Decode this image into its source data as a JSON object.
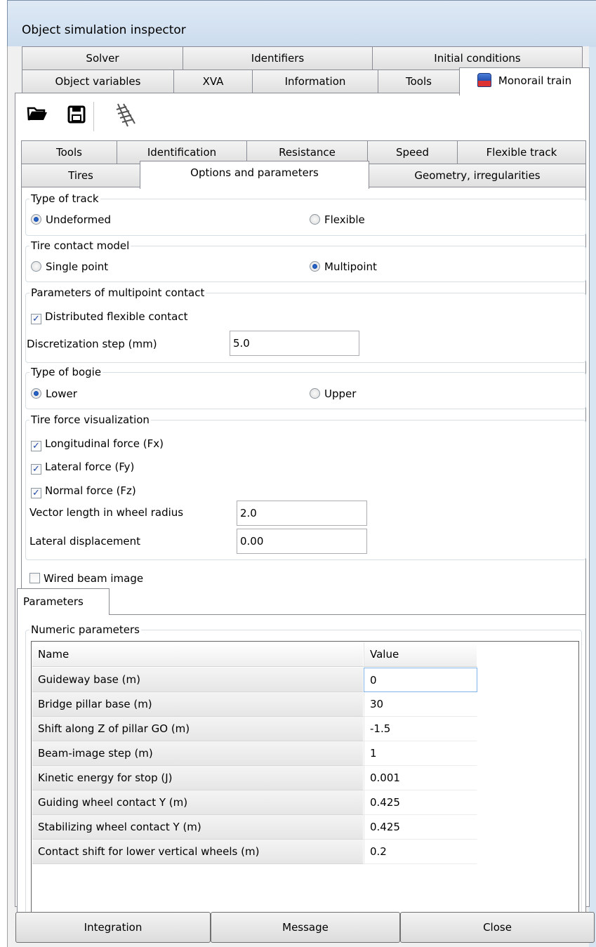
{
  "window": {
    "title": "Object simulation inspector"
  },
  "main_tabs": {
    "row1": [
      "Solver",
      "Identifiers",
      "Initial conditions"
    ],
    "row2": [
      "Object variables",
      "XVA",
      "Information",
      "Tools",
      "Monorail train"
    ]
  },
  "toolbar": {
    "icons": [
      "open-folder-icon",
      "save-icon",
      "track-icon"
    ]
  },
  "sub_tabs": {
    "row1": [
      "Tools",
      "Identification",
      "Resistance",
      "Speed",
      "Flexible track"
    ],
    "row2": [
      "Tires",
      "Options and parameters",
      "Geometry, irregularities"
    ]
  },
  "type_of_track": {
    "label": "Type of track",
    "options": [
      "Undeformed",
      "Flexible"
    ],
    "selected": "Undeformed"
  },
  "tire_contact_model": {
    "label": "Tire contact model",
    "options": [
      "Single point",
      "Multipoint"
    ],
    "selected": "Multipoint"
  },
  "multipoint": {
    "label": "Parameters of multipoint contact",
    "distributed_label": "Distributed flexible contact",
    "distributed_checked": true,
    "step_label": "Discretization step (mm)",
    "step_value": "5.0"
  },
  "type_of_bogie": {
    "label": "Type of bogie",
    "options": [
      "Lower",
      "Upper"
    ],
    "selected": "Lower"
  },
  "tire_force": {
    "label": "Tire force visualization",
    "fx_label": "Longitudinal force (Fx)",
    "fx_checked": true,
    "fy_label": "Lateral force (Fy)",
    "fy_checked": true,
    "fz_label": "Normal force (Fz)",
    "fz_checked": true,
    "vector_label": "Vector length in wheel radius",
    "vector_value": "2.0",
    "lateral_label": "Lateral displacement",
    "lateral_value": "0.00"
  },
  "wired_beam": {
    "label": "Wired beam image",
    "checked": false
  },
  "parameters_tab": "Parameters",
  "numeric": {
    "label": "Numeric parameters",
    "col_name": "Name",
    "col_value": "Value",
    "rows": [
      {
        "name": "Guideway base (m)",
        "value": "0"
      },
      {
        "name": "Bridge pillar base (m)",
        "value": "30"
      },
      {
        "name": "Shift along Z of pillar GO (m)",
        "value": "-1.5"
      },
      {
        "name": "Beam-image step (m)",
        "value": "1"
      },
      {
        "name": "Kinetic energy for stop (J)",
        "value": "0.001"
      },
      {
        "name": "Guiding wheel contact Y (m)",
        "value": "0.425"
      },
      {
        "name": "Stabilizing wheel contact Y (m)",
        "value": "0.425"
      },
      {
        "name": "Contact shift for lower vertical wheels (m)",
        "value": "0.2"
      }
    ]
  },
  "buttons": {
    "integration": "Integration",
    "message": "Message",
    "close": "Close"
  }
}
